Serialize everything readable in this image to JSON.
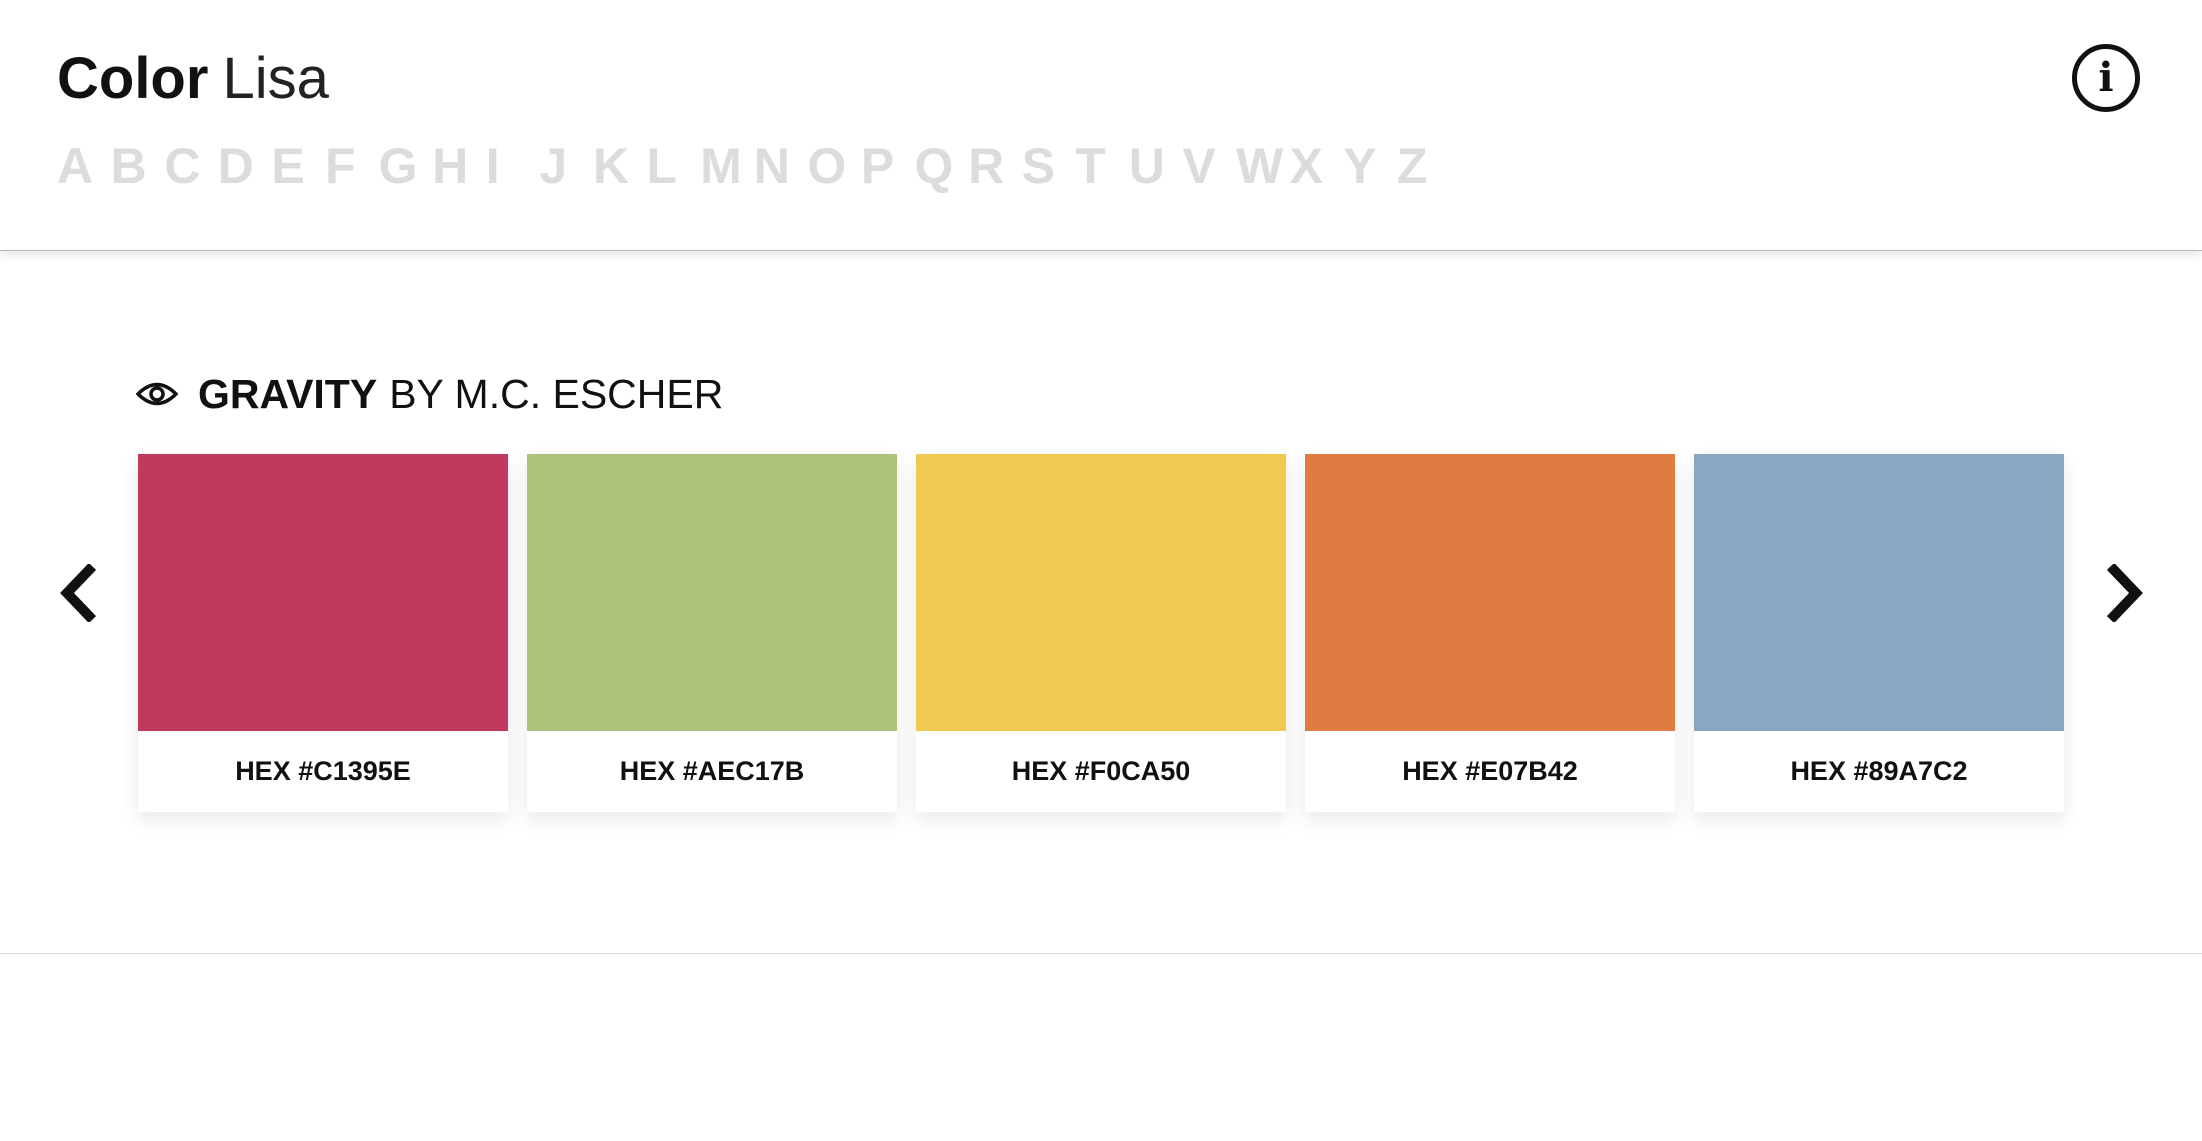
{
  "brand": {
    "name_bold": "Color",
    "name_light": "Lisa"
  },
  "alphabet": [
    "A",
    "B",
    "C",
    "D",
    "E",
    "F",
    "G",
    "H",
    "I",
    "J",
    "K",
    "L",
    "M",
    "N",
    "O",
    "P",
    "Q",
    "R",
    "S",
    "T",
    "U",
    "V",
    "W",
    "X",
    "Y",
    "Z"
  ],
  "info_icon": "i",
  "palette": {
    "artwork": "GRAVITY",
    "byline": "BY M.C. ESCHER",
    "swatches": [
      {
        "color": "#C1395E",
        "label": "HEX #C1395E"
      },
      {
        "color": "#AEC17B",
        "label": "HEX #AEC17B"
      },
      {
        "color": "#F0CA50",
        "label": "HEX #F0CA50"
      },
      {
        "color": "#E07B42",
        "label": "HEX #E07B42"
      },
      {
        "color": "#89A7C2",
        "label": "HEX #89A7C2"
      }
    ]
  },
  "icons": {
    "eye": "eye-icon",
    "info": "info-icon",
    "prev": "chevron-left-icon",
    "next": "chevron-right-icon"
  }
}
